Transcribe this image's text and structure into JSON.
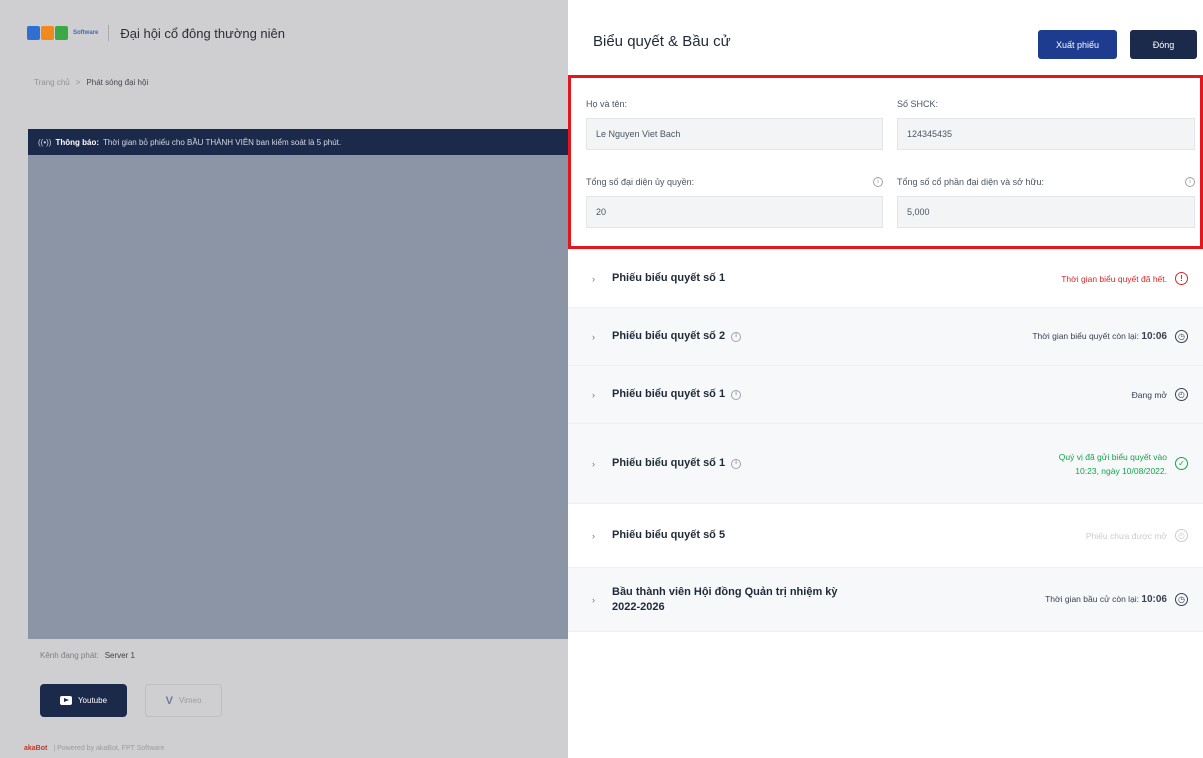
{
  "background_page": {
    "title": "Đại hội cổ đông thường niên",
    "logo_word": "Software",
    "breadcrumb": [
      "Trang chủ",
      ">",
      "Phát sóng đại hội"
    ],
    "notice_prefix": "Thông báo:",
    "notice_text": "Thời gian bỏ phiếu cho BẦU THÀNH VIÊN ban kiểm soát là 5 phút.",
    "channel_label": "Kênh đang phát:",
    "channel_value": "Server 1",
    "youtube_label": "Youtube",
    "vimeo_label": "Vimeo",
    "footer_brand": "akaBot",
    "footer_text": "| Powered by akaBot, FPT Software"
  },
  "drawer": {
    "title": "Biểu quyết & Bầu cử",
    "export_label": "Xuất phiếu",
    "close_label": "Đóng"
  },
  "info": {
    "name_label": "Họ và tên:",
    "name_value": "Le Nguyen Viet Bach",
    "id_label": "Số SHCK:",
    "id_value": "124345435",
    "proxy_label": "Tổng số đại diện ủy quyền:",
    "proxy_value": "20",
    "shares_label": "Tổng số cổ phần đại diện và sở hữu:",
    "shares_value": "5,000"
  },
  "ballots": [
    {
      "title": "Phiếu biểu quyết số 1",
      "status": "Thời gian biểu quyết đã hết.",
      "status_color": "#dc2626",
      "icon": "alert-icon"
    },
    {
      "title": "Phiếu biểu quyết số 2",
      "status": "Thời gian biểu quyết còn lại:",
      "status_strong": "10:06",
      "status_color": "#374151",
      "icon": "timer-icon"
    },
    {
      "title": "Phiếu biểu quyết số 1",
      "status": "Đang mở",
      "status_color": "#374151",
      "icon": "clock-icon"
    },
    {
      "title": "Phiếu biểu quyết số 1",
      "status": "Quý vị đã gửi biểu quyết vào",
      "status_line2": "10:23, ngày 10/08/2022.",
      "status_color": "#16a34a",
      "icon": "check-circle-icon"
    },
    {
      "title": "Phiếu biểu quyết số 5",
      "status": "Phiếu chưa được mở",
      "status_color": "#c9ccd1",
      "icon": "clock-disabled-icon"
    },
    {
      "title": "Bầu thành viên Hội đồng Quản trị nhiệm kỳ",
      "title_line2": "2022-2026",
      "status": "Thời gian bầu cử còn lại:",
      "status_strong": "10:06",
      "status_color": "#374151",
      "icon": "timer-icon"
    }
  ],
  "colors": {
    "primary": "#1d3b8f",
    "navy": "#1b2a4a",
    "highlight_box": "#e2161b"
  }
}
